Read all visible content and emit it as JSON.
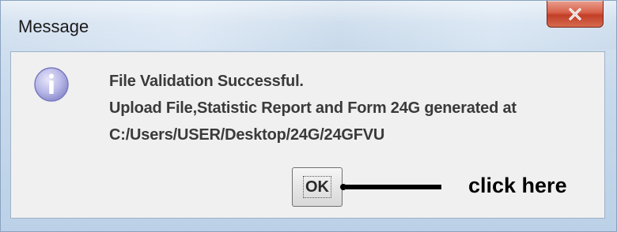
{
  "dialog": {
    "title": "Message",
    "close_label": "x",
    "icon": "info-icon",
    "message_lines": [
      "File Validation Successful.",
      "Upload File,Statistic Report and Form 24G generated at",
      "C:/Users/USER/Desktop/24G/24GFVU"
    ],
    "ok_label": "OK"
  },
  "annotation": {
    "text": "click here",
    "arrow": "arrow-pointing-to-ok-button"
  },
  "colors": {
    "content_bg": "#f0f0f0",
    "close_button": "#d0503a",
    "message_text": "#3a3a3a",
    "info_icon_fill": "#b8b8e6"
  }
}
